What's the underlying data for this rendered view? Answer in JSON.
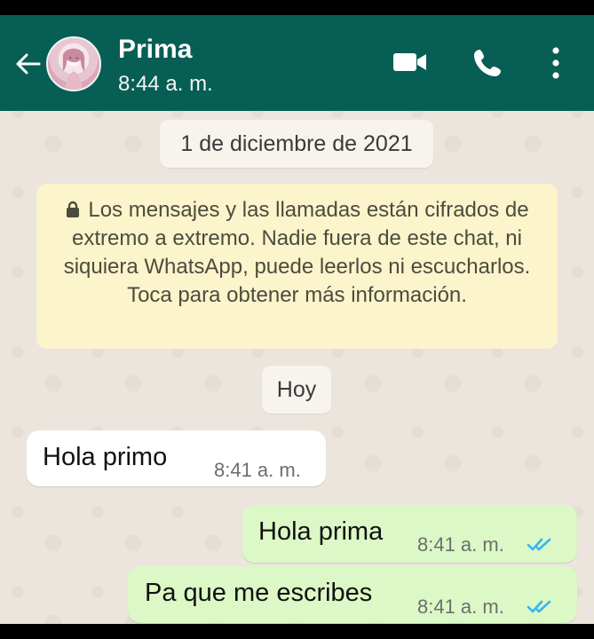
{
  "header": {
    "contact_name": "Prima",
    "last_seen": "8:44 a. m.",
    "icons": [
      "back-arrow-icon",
      "avatar",
      "video-call-icon",
      "phone-icon",
      "more-vert-icon"
    ]
  },
  "chat": {
    "date_chip": "1 de diciembre de 2021",
    "encryption_notice": "Los mensajes y las llamadas están cifrados de extremo a extremo. Nadie fuera de este chat, ni siquiera WhatsApp, puede leerlos ni escucharlos. Toca para obtener más información.",
    "today_chip": "Hoy",
    "messages": [
      {
        "direction": "incoming",
        "text": "Hola primo",
        "time": "8:41 a. m."
      },
      {
        "direction": "outgoing",
        "text": "Hola prima",
        "time": "8:41 a. m.",
        "status": "read"
      },
      {
        "direction": "outgoing",
        "text": "Pa que me escribes",
        "time": "8:41 a. m.",
        "status": "read"
      }
    ]
  },
  "colors": {
    "header": "#075e54",
    "chat_background": "#ece5dd",
    "incoming_bubble": "#ffffff",
    "outgoing_bubble": "#dcf8c6",
    "notice_background": "#fcf4cb",
    "read_ticks": "#34b7f1"
  }
}
